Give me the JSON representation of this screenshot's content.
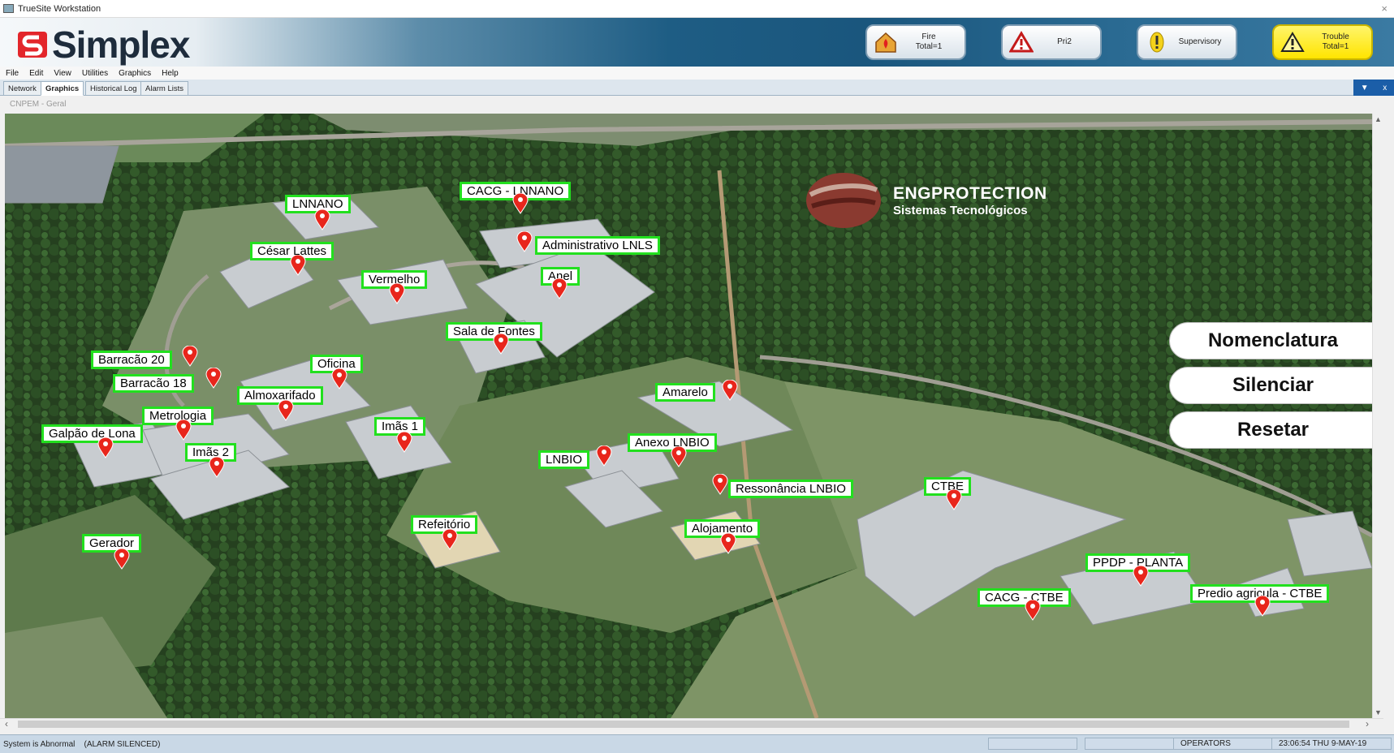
{
  "window": {
    "title": "TrueSite Workstation"
  },
  "brand": {
    "name": "Simplex"
  },
  "status_buttons": {
    "fire": "Fire\nTotal=1",
    "pri2": "Pri2",
    "supervisory": "Supervisory",
    "trouble": "Trouble\nTotal=1"
  },
  "menu": [
    "File",
    "Edit",
    "View",
    "Utilities",
    "Graphics",
    "Help"
  ],
  "tabs": [
    "Network",
    "Graphics",
    "Historical Log",
    "Alarm Lists"
  ],
  "tab_tools": {
    "dropdown": "▼",
    "close": "x"
  },
  "breadcrumb": "CNPEM - Geral",
  "watermark": {
    "title": "ENGPROTECTION",
    "subtitle": "Sistemas Tecnológicos"
  },
  "locations": [
    "LNNANO",
    "CACG - LNNANO",
    "César Lattes",
    "Administrativo LNLS",
    "Vermelho",
    "Anel",
    "Sala de Fontes",
    "Barracão 20",
    "Oficina",
    "Barracão 18",
    "Almoxarifado",
    "Metrologia",
    "Galpão de Lona",
    "Imãs 1",
    "Imãs 2",
    "Amarelo",
    "Anexo LNBIO",
    "LNBIO",
    "Ressonância LNBIO",
    "CTBE",
    "Refeitório",
    "Alojamento",
    "Gerador",
    "PPDP - PLANTA",
    "CACG - CTBE",
    "Predio agricula - CTBE"
  ],
  "actions": {
    "nomenclatura": "Nomenclatura",
    "silenciar": "Silenciar",
    "resetar": "Resetar"
  },
  "statusbar": {
    "message": "System is Abnormal",
    "alarm_state": "(ALARM SILENCED)",
    "operator": "OPERATORS",
    "datetime": "23:06:54 THU 9-MAY-19"
  },
  "colors": {
    "label_border": "#22e01e",
    "pin": "#e8261c",
    "trouble": "#ffe400",
    "tab_tools": "#1b5ea8"
  }
}
